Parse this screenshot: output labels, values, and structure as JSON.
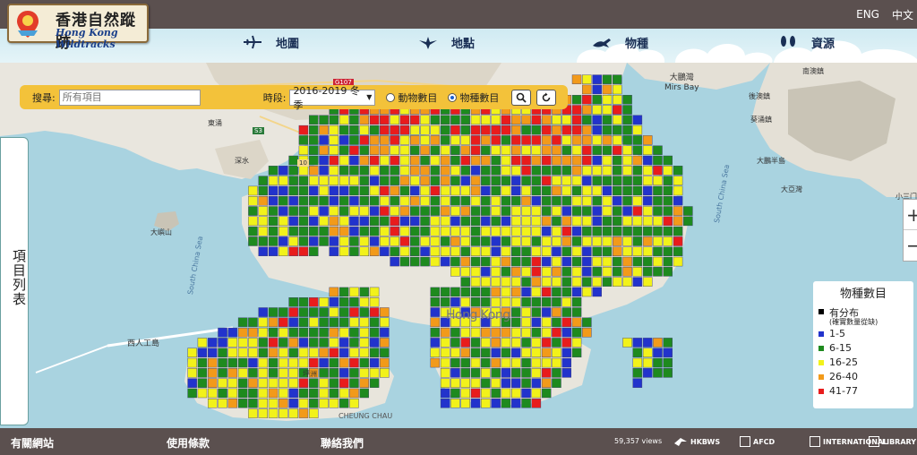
{
  "header": {
    "logo_zh": "香港自然蹤跡",
    "logo_en": "Hong Kong Wildtracks",
    "lang_en": "ENG",
    "lang_zh": "中文"
  },
  "nav": {
    "items": [
      {
        "label": "地圖",
        "icon": "plane-icon"
      },
      {
        "label": "地點",
        "icon": "bird-icon"
      },
      {
        "label": "物種",
        "icon": "animal-icon"
      },
      {
        "label": "資源",
        "icon": "footprints-icon"
      }
    ]
  },
  "search": {
    "label": "搜尋:",
    "placeholder": "所有項目",
    "period_label": "時段:",
    "period_value": "2016-2019 冬季",
    "radio_animals": "動物數目",
    "radio_species": "物種數目",
    "selected": "species"
  },
  "sidebar": {
    "tab_label": "項目列表"
  },
  "zoom": {
    "in": "+",
    "out": "−"
  },
  "legend": {
    "title": "物種數目",
    "items": [
      {
        "label": "有分布",
        "sub": "(確實數量從缺)",
        "color": "#000000"
      },
      {
        "label": "1-5",
        "color": "#2233cc"
      },
      {
        "label": "6-15",
        "color": "#1e8a1e"
      },
      {
        "label": "16-25",
        "color": "#f2f21a"
      },
      {
        "label": "26-40",
        "color": "#f29a1a"
      },
      {
        "label": "41-77",
        "color": "#e81c1c"
      }
    ]
  },
  "map_labels": {
    "mirs_bay_zh": "大鵬灣",
    "mirs_bay_en": "Mirs Bay",
    "south_china_sea": "South China Sea",
    "hong_kong": "Hong Kong",
    "cheung_chau": "CHEUNG CHAU",
    "west_road": "西人工島",
    "place1": "大鵬半島",
    "place2": "大亞灣",
    "place3": "南澳鎮",
    "place4": "小三门",
    "place5": "後澳鎮",
    "place6": "葵涌鎮",
    "place7": "東涌",
    "place8": "坪洲",
    "place9": "深水",
    "place10": "大嶼山",
    "road1": "G107",
    "road2": "S3",
    "road3": "10"
  },
  "footer": {
    "links": [
      "有關網站",
      "使用條款",
      "聯絡我們"
    ],
    "views": "59,357 views",
    "logos": [
      "HKBWS",
      "AFCD",
      "INTERNATIONAL",
      "LIBRARY"
    ]
  }
}
